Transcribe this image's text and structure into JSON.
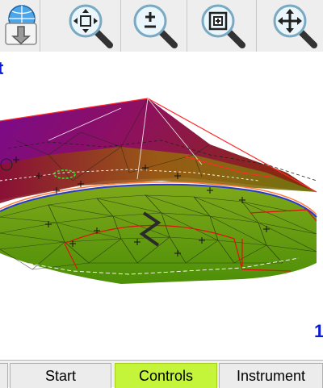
{
  "toolbar": {
    "buttons": [
      {
        "name": "import-globe",
        "icon": "globe-down-arrow-icon"
      },
      {
        "name": "zoom-extents",
        "icon": "zoom-extents-magnifier-icon"
      },
      {
        "name": "zoom-in-out",
        "icon": "zoom-plus-minus-magnifier-icon"
      },
      {
        "name": "zoom-window",
        "icon": "zoom-window-magnifier-icon"
      },
      {
        "name": "pan",
        "icon": "pan-arrows-magnifier-icon"
      }
    ]
  },
  "viewport": {
    "corner_top_left": "t",
    "corner_bottom_right": "1"
  },
  "tabs": {
    "items": [
      "",
      "Start",
      "Controls",
      "Instrument"
    ],
    "active": "Controls",
    "active_color": "#c5f53a"
  },
  "colors": {
    "label_blue": "#0a1bd8",
    "surface_purple": "#7a0a7a",
    "surface_red": "#9a1040",
    "surface_olive": "#6a7a08",
    "surface_green": "#5aa00a",
    "boundary_red": "#e01010"
  }
}
